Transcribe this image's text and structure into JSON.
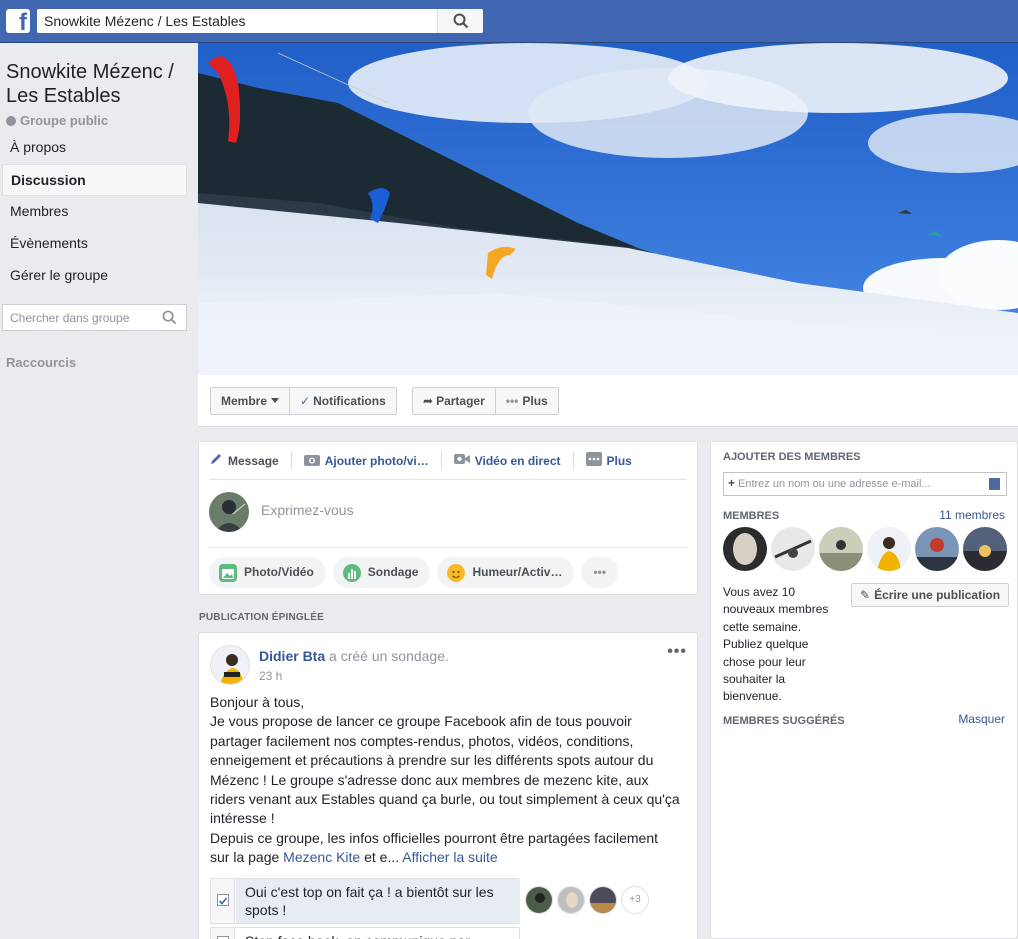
{
  "topbar": {
    "logo_letter": "f",
    "search_value": "Snowkite Mézenc / Les Estables"
  },
  "group": {
    "title": "Snowkite Mézenc / Les Estables",
    "type": "Groupe public"
  },
  "nav": {
    "items": [
      {
        "label": "À propos"
      },
      {
        "label": "Discussion",
        "active": true
      },
      {
        "label": "Membres"
      },
      {
        "label": "Évènements"
      },
      {
        "label": "Gérer le groupe"
      }
    ],
    "search_placeholder": "Chercher dans groupe",
    "shortcuts_label": "Raccourcis"
  },
  "actions": {
    "membre": "Membre",
    "notifications": "Notifications",
    "partager": "Partager",
    "plus": "Plus"
  },
  "composer": {
    "tabs": [
      "Message",
      "Ajouter photo/vi…",
      "Vidéo en direct",
      "Plus"
    ],
    "placeholder": "Exprimez-vous",
    "chips": [
      "Photo/Vidéo",
      "Sondage",
      "Humeur/Activ…"
    ],
    "more_chip": "•••"
  },
  "pinned_label": "PUBLICATION ÉPINGLÉE",
  "post": {
    "author": "Didier Bta",
    "action": " a créé un sondage.",
    "time": "23 h",
    "menu": "•••",
    "line1": "Bonjour à tous,",
    "body": "Je vous propose de lancer ce groupe Facebook afin de tous pouvoir partager facilement nos comptes-rendus, photos, vidéos, conditions, enneigement et précautions à prendre sur les différents spots autour du Mézenc ! Le groupe s'adresse donc aux membres de mezenc kite, aux riders venant aux Estables quand ça burle, ou tout simplement à ceux qu'ça intéresse !",
    "body2_prefix": "Depuis ce groupe, les infos officielles pourront être partagées facilement sur la page ",
    "body2_link": "Mezenc Kite",
    "body2_suffix": " et e... ",
    "see_more": "Afficher la suite",
    "poll": [
      {
        "label": "Oui c'est top on fait ça ! a bientôt sur les spots !",
        "checked": true
      },
      {
        "label": "Stop face book, on communique par...",
        "checked": false
      }
    ],
    "voters_more": "+3"
  },
  "right": {
    "add_heading": "AJOUTER DES MEMBRES",
    "add_placeholder": "Entrez un nom ou une adresse e-mail...",
    "members_heading": "MEMBRES",
    "members_count": "11 membres",
    "welcome": "Vous avez 10 nouveaux membres cette semaine. Publiez quelque chose pour leur souhaiter la bienvenue.",
    "write_btn": "Écrire une publication",
    "suggested_heading": "MEMBRES SUGGÉRÉS",
    "hide": "Masquer"
  },
  "colors": {
    "brand": "#4267b2",
    "link": "#365899",
    "background": "#e9ebee"
  }
}
